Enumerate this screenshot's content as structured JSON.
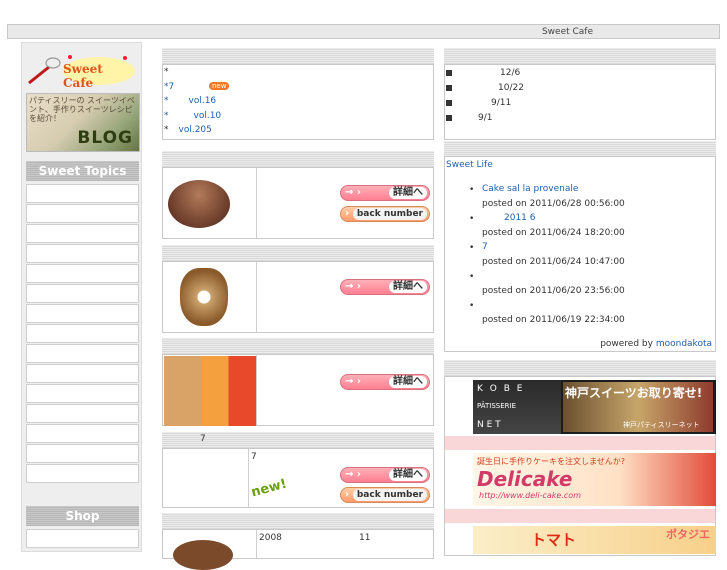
{
  "header": {
    "title": "Sweet Cafe"
  },
  "left": {
    "logo_text": "Sweet Cafe",
    "blog_text": "パティスリーの スイーツイベント、手作りスイーツレシピを紹介！",
    "blog_title": "BLOG",
    "topics_title": "Sweet Topics",
    "shop_title": "Shop"
  },
  "news": {
    "items": [
      {
        "bullet": "*",
        "text": ""
      },
      {
        "bullet": "*7",
        "text": "",
        "badge": "new"
      },
      {
        "bullet": "*",
        "text": "vol.16"
      },
      {
        "bullet": "*",
        "text": "vol.10"
      },
      {
        "bullet": "*",
        "text": "vol.205"
      }
    ]
  },
  "features": [
    {
      "btn1": "詳細へ",
      "btn2": "back number"
    },
    {
      "btn1": "詳細へ"
    },
    {
      "btn1": "詳細へ"
    },
    {
      "heading": "7",
      "label": "7",
      "badge": "new!",
      "btn1": "詳細へ",
      "btn2": "back number"
    },
    {
      "date": "2008",
      "date2": "11"
    }
  ],
  "right": {
    "dates": [
      "12/6",
      "10/22",
      "9/11",
      "9/1"
    ],
    "blog_title": "Sweet Life",
    "posts": [
      {
        "title": "Cake sal la provenale",
        "meta": "posted on 2011/06/28 00:56:00"
      },
      {
        "title": "2011 6",
        "meta": "posted on 2011/06/24 18:20:00"
      },
      {
        "title": "7",
        "meta": "posted on 2011/06/24 10:47:00"
      },
      {
        "title": "",
        "meta": "posted on 2011/06/20 23:56:00"
      },
      {
        "title": "",
        "meta": "posted on 2011/06/19 22:34:00"
      }
    ],
    "powered_prefix": "powered by",
    "powered_link": "moondakota",
    "banners": [
      {
        "left": "K O B E",
        "mid": "PÂTISSERIE",
        "bottom": "N   E   T",
        "title": "神戸スイーツお取り寄せ!",
        "sub": "神戸パティスリーネット"
      },
      {
        "top": "誕生日に手作りケーキを注文しませんか?",
        "title": "Delicake",
        "url": "http://www.deli-cake.com"
      },
      {
        "title": "トマト",
        "sub": "ポタジエ"
      }
    ]
  }
}
